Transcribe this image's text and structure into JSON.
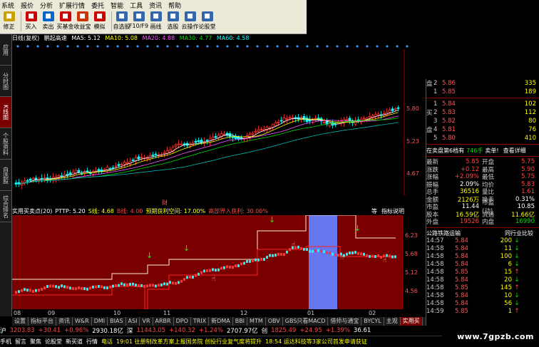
{
  "menu": [
    "系统",
    "报价",
    "分析",
    "扩展行情",
    "委托",
    "智能",
    "工具",
    "资讯",
    "帮助"
  ],
  "toolbar": [
    {
      "label": "修正",
      "icon": "back-icon",
      "color": "#caa000"
    },
    {
      "label": "买入",
      "icon": "buy-icon",
      "color": "#cc0000"
    },
    {
      "label": "卖出",
      "icon": "sell-icon",
      "color": "#0066cc"
    },
    {
      "label": "买基金",
      "icon": "fund-icon",
      "color": "#cc0000"
    },
    {
      "label": "收益宝",
      "icon": "bank-icon",
      "color": "#cc3300"
    },
    {
      "label": "模拟",
      "icon": "sim-icon",
      "color": "#cc0000"
    },
    {
      "label": "自选股",
      "icon": "star-icon",
      "color": "#3366aa"
    },
    {
      "label": "F10/F9",
      "icon": "f10-icon",
      "color": "#3366aa"
    },
    {
      "label": "画线",
      "icon": "draw-icon",
      "color": "#3366aa"
    },
    {
      "label": "选股",
      "icon": "filter-icon",
      "color": "#3366aa"
    },
    {
      "label": "云操作",
      "icon": "cloud-icon",
      "color": "#3366aa"
    },
    {
      "label": "论股堂",
      "icon": "forum-icon",
      "color": "#3366aa"
    }
  ],
  "side_tabs": [
    "应用",
    "分时图",
    "K线图",
    "个股资料",
    "自选股",
    "综合排名"
  ],
  "side_active": 2,
  "title_row": {
    "period": "日线(复权)",
    "name": "鹏起高速",
    "ma5": "MA5: 5.12",
    "ma10": "MA10: 5.08",
    "ma20": "MA20: 4.88",
    "ma30": "MA30: 4.77",
    "ma60": "MA60: 4.58"
  },
  "price_axis": [
    "5.80",
    "5.23",
    "4.67"
  ],
  "finance_marker": "财",
  "indicator_row": {
    "name": "实用买卖点(20)",
    "pttp": "PTTP: 5.20",
    "s": "S线: 4.68",
    "b": "B线: 4.00",
    "profit_space": "预期获利空间: 17.00%",
    "stop": "高部界入获利: 30.00%",
    "btn1": "等",
    "btn2": "指标说明"
  },
  "sub_axis": [
    "6.23",
    "5.68",
    "5.12",
    "4.56"
  ],
  "dates": [
    "08",
    "09",
    "10",
    "11",
    "12",
    "01",
    "02"
  ],
  "bottom_tabs": [
    "设置",
    "指标平台",
    "资讯",
    "W&R",
    "DMI",
    "BIAS",
    "ASI",
    "VR",
    "ARBR",
    "DPO",
    "TRIX",
    "新DMA",
    "BBI",
    "MTM",
    "OBV",
    "GBS只看MACD",
    "借师与通宝",
    "BYCYL",
    "主观",
    "实用买"
  ],
  "bottom_active": 19,
  "index_bar": [
    {
      "t": "沪",
      "c": "w"
    },
    {
      "t": "3203.83",
      "c": "r"
    },
    {
      "t": "+30.41",
      "c": "r"
    },
    {
      "t": "+0.96%",
      "c": "r"
    },
    {
      "t": "2930.18亿",
      "c": "w"
    },
    {
      "t": "深",
      "c": "w"
    },
    {
      "t": "11443.05",
      "c": "r"
    },
    {
      "t": "+140.32",
      "c": "r"
    },
    {
      "t": "+1.24%",
      "c": "r"
    },
    {
      "t": "2707.97亿",
      "c": "w"
    },
    {
      "t": "创",
      "c": "w"
    },
    {
      "t": "1825.49",
      "c": "r"
    },
    {
      "t": "+24.95",
      "c": "r"
    },
    {
      "t": "+1.39%",
      "c": "r"
    },
    {
      "t": "36.61",
      "c": "w"
    }
  ],
  "status_bar": [
    {
      "t": "手机",
      "c": "w"
    },
    {
      "t": "留言",
      "c": "w"
    },
    {
      "t": "聚焦",
      "c": "w"
    },
    {
      "t": "论股堂",
      "c": "w"
    },
    {
      "t": "新买道",
      "c": "w"
    },
    {
      "t": "行情",
      "c": "w"
    },
    {
      "t": "电话",
      "c": "y"
    },
    {
      "t": "19:01 往册制改革方案上报国务院 创投行业复气度将提升",
      "c": "y"
    },
    {
      "t": "18:54 运达科技等3家公司首发申请获证",
      "c": "y"
    }
  ],
  "orderbook_sell": [
    {
      "side": "盘",
      "lv": "2",
      "price": "5.86",
      "vol": "335"
    },
    {
      "side": "",
      "lv": "1",
      "price": "5.85",
      "vol": "189"
    }
  ],
  "orderbook_buy": [
    {
      "side": "",
      "lv": "1",
      "price": "5.84",
      "vol": "102"
    },
    {
      "side": "买",
      "lv": "2",
      "price": "5.83",
      "vol": "112"
    },
    {
      "side": "",
      "lv": "3",
      "price": "5.82",
      "vol": "80"
    },
    {
      "side": "盘",
      "lv": "4",
      "price": "5.81",
      "vol": "76"
    },
    {
      "side": "",
      "lv": "5",
      "price": "5.80",
      "vol": "410"
    }
  ],
  "panel_tabs": {
    "a": "在卖盘第6档有",
    "b": "746手",
    "c": "卖单!",
    "d": "查看详细"
  },
  "quote": [
    {
      "k": "最新",
      "v": "5.85",
      "vc": "r",
      "k2": "开盘",
      "v2": "5.75",
      "v2c": "r"
    },
    {
      "k": "涨跌",
      "v": "+0.12",
      "vc": "r",
      "k2": "最高",
      "v2": "5.90",
      "v2c": "r"
    },
    {
      "k": "涨幅",
      "v": "+2.09%",
      "vc": "r",
      "k2": "最低",
      "v2": "5.75",
      "v2c": "r"
    },
    {
      "k": "振幅",
      "v": "2.09%",
      "vc": "w",
      "k2": "均价",
      "v2": "5.83",
      "v2c": "r"
    },
    {
      "k": "总手",
      "v": "36516",
      "vc": "y",
      "k2": "量比",
      "v2": "1.61",
      "v2c": "r"
    },
    {
      "k": "金额",
      "v": "2126万",
      "vc": "y",
      "k2": "换手",
      "v2": "0.31%",
      "v2c": "w"
    },
    {
      "k": "市盈",
      "v": "11.44",
      "vc": "w",
      "k2": "市盈(动)",
      "v2": "10.85",
      "v2c": "w"
    },
    {
      "k": "股本",
      "v": "16.59亿",
      "vc": "y",
      "k2": "流通",
      "v2": "11.66亿",
      "v2c": "y"
    },
    {
      "k": "外盘",
      "v": "19526",
      "vc": "r",
      "k2": "内盘",
      "v2": "16990",
      "v2c": "g"
    }
  ],
  "industry": {
    "a": "公路铁路运输",
    "b": "同行业比较"
  },
  "trades": [
    {
      "t": "14:57",
      "p": "5.84",
      "v": "200",
      "ar": "down"
    },
    {
      "t": "14:58",
      "p": "5.84",
      "v": "11",
      "ar": "down"
    },
    {
      "t": "14:58",
      "p": "5.84",
      "v": "100",
      "ar": "down"
    },
    {
      "t": "14:58",
      "p": "5.84",
      "v": "6",
      "ar": "down"
    },
    {
      "t": "14:58",
      "p": "5.85",
      "v": "15",
      "ar": "up"
    },
    {
      "t": "14:58",
      "p": "5.84",
      "v": "20",
      "ar": "down"
    },
    {
      "t": "14:58",
      "p": "5.85",
      "v": "145",
      "ar": "up"
    },
    {
      "t": "14:58",
      "p": "5.84",
      "v": "10",
      "ar": "down"
    },
    {
      "t": "14:58",
      "p": "5.84",
      "v": "56",
      "ar": "down"
    },
    {
      "t": "14:59",
      "p": "5.85",
      "v": "1",
      "ar": "up"
    }
  ],
  "watermark": "www.7gpzb.com"
}
